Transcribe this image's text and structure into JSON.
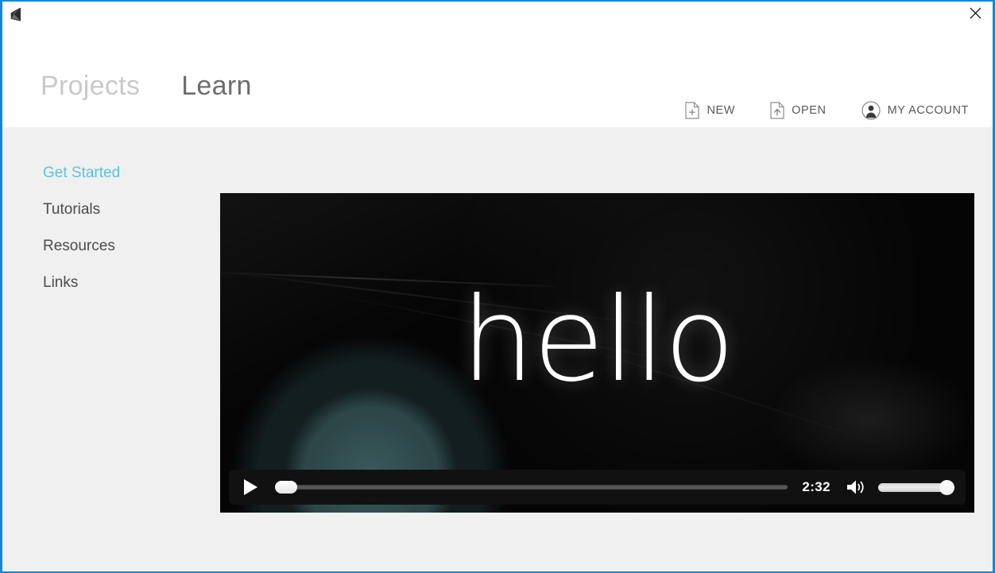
{
  "window": {
    "logo_icon": "unity-logo-icon",
    "close_label": "×",
    "border_color": "#1287d8",
    "background_color": "#f0f0f0"
  },
  "header": {
    "tabs": [
      {
        "label": "Projects",
        "active": false
      },
      {
        "label": "Learn",
        "active": true
      }
    ],
    "active_tab_underline_color": "#1fc3da",
    "actions": [
      {
        "label": "NEW",
        "icon": "new-document-icon"
      },
      {
        "label": "OPEN",
        "icon": "open-document-icon"
      },
      {
        "label": "MY ACCOUNT",
        "icon": "account-avatar-icon"
      }
    ]
  },
  "sidebar": {
    "items": [
      {
        "label": "Get Started",
        "active": true
      },
      {
        "label": "Tutorials",
        "active": false
      },
      {
        "label": "Resources",
        "active": false
      },
      {
        "label": "Links",
        "active": false
      }
    ],
    "active_color": "#56c5dd",
    "item_color": "#4c4c4c"
  },
  "video": {
    "overlay_text": "hello",
    "controls": {
      "play_icon": "play-icon",
      "play_label": "Play",
      "progress_percent": 0,
      "time": "2:32",
      "volume_icon": "volume-high-icon",
      "volume_percent": 100
    }
  }
}
